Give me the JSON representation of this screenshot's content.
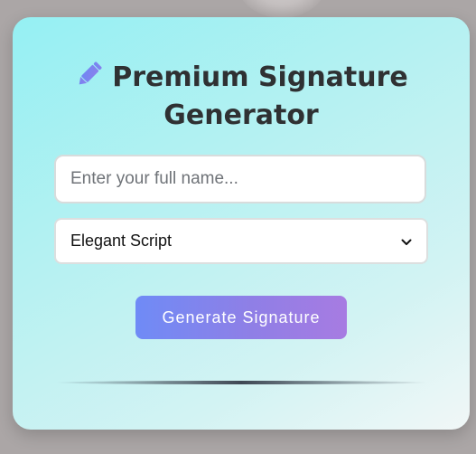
{
  "header": {
    "title": "Premium Signature Generator",
    "icon": "pen-icon"
  },
  "name_input": {
    "value": "",
    "placeholder": "Enter your full name..."
  },
  "style_select": {
    "selected": "Elegant Script",
    "icon": "chevron-down-icon"
  },
  "generate_button": {
    "label": "Generate Signature"
  },
  "colors": {
    "accent_start": "#6f8bf6",
    "accent_end": "#a77be2",
    "title_text": "#2f3133",
    "card_gradient_start": "#95f0f3",
    "card_gradient_end": "#f1f7f7",
    "background": "#aba6a6"
  }
}
